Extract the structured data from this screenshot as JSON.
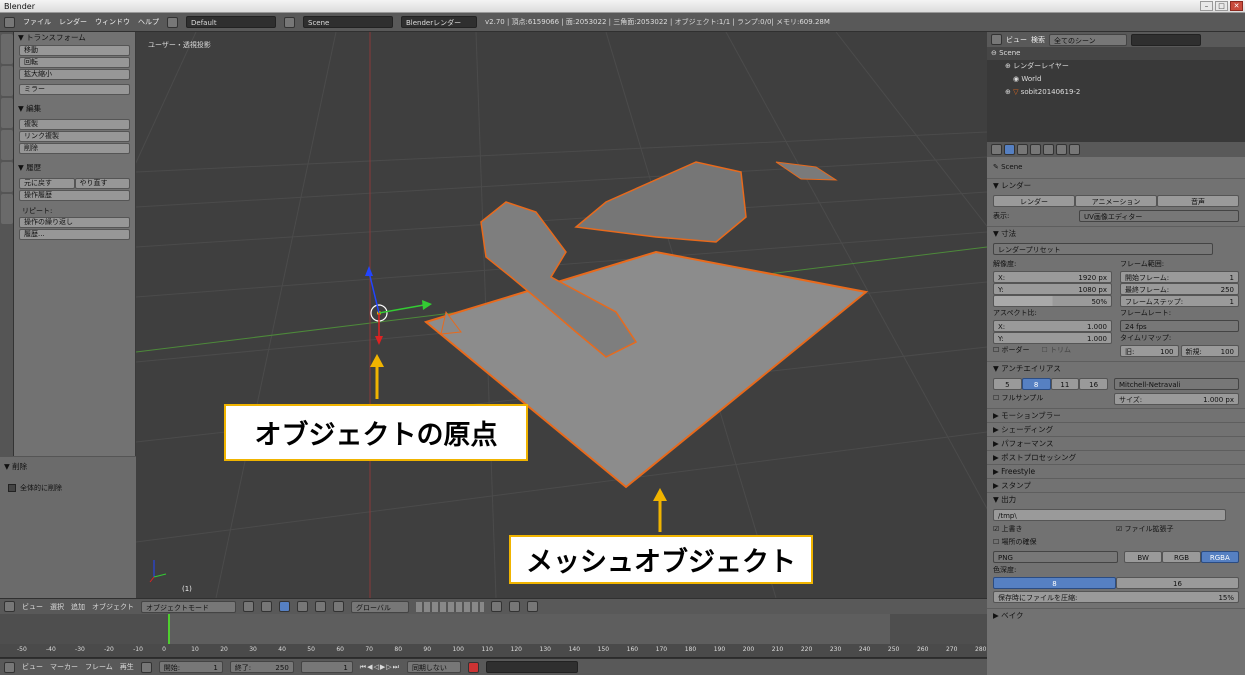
{
  "window": {
    "title": "Blender"
  },
  "menubar": {
    "items": [
      "ファイル",
      "レンダー",
      "ウィンドウ",
      "ヘルプ"
    ],
    "layout_value": "Default",
    "scene_value": "Scene",
    "engine_value": "Blenderレンダー",
    "stats": "v2.70 | 頂点:6159066 | 面:2053022 | 三角面:2053022 | オブジェクト:1/1 | ランプ:0/0| メモリ:609.28M"
  },
  "toolshelf": {
    "transform": {
      "title": "▼ トランスフォーム",
      "buttons": [
        "移動",
        "回転",
        "拡大縮小",
        "ミラー"
      ]
    },
    "edit": {
      "title": "▼ 編集",
      "buttons": [
        "複製",
        "リンク複製",
        "削除"
      ]
    },
    "history": {
      "title": "▼ 履歴",
      "undo": "元に戻す",
      "redo": "やり直す",
      "undo_history": "操作履歴",
      "repeat_label": "リピート:",
      "repeat": "操作の繰り返し",
      "history": "履歴..."
    },
    "delete_op": {
      "title": "▼ 削除",
      "checkbox": "全体的に削除"
    }
  },
  "viewport": {
    "label": "ユーザー・透視投影",
    "frame": "(1)",
    "callout_origin": "オブジェクトの原点",
    "callout_mesh": "メッシュオブジェクト"
  },
  "viewport_header": {
    "menus": [
      "ビュー",
      "選択",
      "追加",
      "オブジェクト"
    ],
    "mode": "オブジェクトモード",
    "orientation": "グローバル"
  },
  "outliner": {
    "menus": [
      "ビュー",
      "検索"
    ],
    "filter": "全てのシーン",
    "rows": [
      "Scene",
      "レンダーレイヤー",
      "World",
      "sobit20140619-2"
    ]
  },
  "properties": {
    "scene": "Scene",
    "render_title": "▼ レンダー",
    "render_buttons": [
      "レンダー",
      "アニメーション",
      "音声"
    ],
    "display_label": "表示:",
    "display_value": "UV画像エディター",
    "dimensions_title": "▼ 寸法",
    "preset": "レンダープリセット",
    "resolution_label": "解像度:",
    "res_x": "X:",
    "res_x_val": "1920 px",
    "res_y": "Y:",
    "res_y_val": "1080 px",
    "res_pct": "50%",
    "frame_range_label": "フレーム範囲:",
    "start_frame": "開始フレーム:",
    "start_frame_val": "1",
    "end_frame": "最終フレーム:",
    "end_frame_val": "250",
    "frame_step": "フレームステップ:",
    "frame_step_val": "1",
    "aspect_label": "アスペクト比:",
    "asp_x": "X:",
    "asp_x_val": "1.000",
    "asp_y": "Y:",
    "asp_y_val": "1.000",
    "framerate_label": "フレームレート:",
    "framerate_val": "24 fps",
    "timeremap_label": "タイムリマップ:",
    "old": "旧:",
    "old_val": "100",
    "new": "新規:",
    "new_val": "100",
    "border": "ボーダー",
    "trim": "トリム",
    "aa_title": "▼ アンチエイリアス",
    "aa_samples": [
      "5",
      "8",
      "11",
      "16"
    ],
    "aa_filter": "Mitchell-Netravali",
    "fullsample": "フルサンプル",
    "size_label": "サイズ:",
    "size_val": "1.000 px",
    "sections": [
      "▶ モーションブラー",
      "▶ シェーディング",
      "▶ パフォーマンス",
      "▶ ポストプロセッシング",
      "▶ Freestyle",
      "▶ スタンプ"
    ],
    "output_title": "▼ 出力",
    "output_path": "/tmp\\",
    "overwrite": "上書き",
    "file_ext": "ファイル拡張子",
    "placeholders": "場所の確保",
    "format": "PNG",
    "color_modes": [
      "BW",
      "RGB",
      "RGBA"
    ],
    "depth_label": "色深度:",
    "depth_vals": [
      "8",
      "16"
    ],
    "compression": "保存時にファイルを圧縮:",
    "compression_val": "15%",
    "bake_title": "▶ ベイク"
  },
  "timeline": {
    "menus": [
      "ビュー",
      "マーカー",
      "フレーム",
      "再生"
    ],
    "start_label": "開始:",
    "start_val": "1",
    "end_label": "終了:",
    "end_val": "250",
    "current": "1",
    "sync": "同期しない",
    "ticks": [
      "-50",
      "-40",
      "-30",
      "-20",
      "-10",
      "0",
      "10",
      "20",
      "30",
      "40",
      "50",
      "60",
      "70",
      "80",
      "90",
      "100",
      "110",
      "120",
      "130",
      "140",
      "150",
      "160",
      "170",
      "180",
      "190",
      "200",
      "210",
      "220",
      "230",
      "240",
      "250",
      "260",
      "270",
      "280"
    ]
  },
  "colors": {
    "accent_select": "#5680c2",
    "callout_border": "#f0b400",
    "axis_red": "#d22",
    "axis_green": "#3c3",
    "axis_blue": "#24f"
  }
}
